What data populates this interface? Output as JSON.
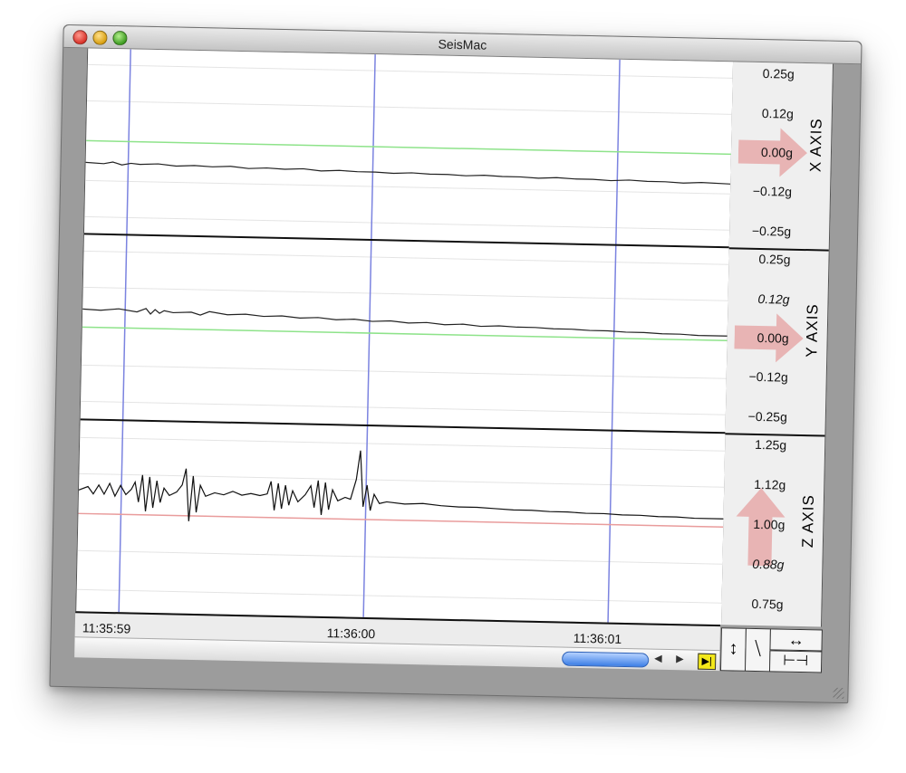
{
  "window": {
    "title": "SeisMac"
  },
  "icons": {
    "close": "close-button-icon",
    "minimize": "minimize-button-icon",
    "zoom": "zoom-button-icon",
    "vertical_zoom": "double-arrow-vertical-icon",
    "vertical_compress": "compress-vertical-icon",
    "horizontal_zoom": "double-arrow-horizontal-icon",
    "horizontal_compress": "compress-horizontal-icon",
    "scroll_left": "arrow-left-icon",
    "scroll_right": "arrow-right-icon",
    "jump_to_end": "jump-to-end-icon"
  },
  "colors": {
    "gridline_blue": "#7b83e0",
    "x_baseline": "#8ee38a",
    "y_baseline": "#8ee38a",
    "z_baseline": "#e99c9c",
    "axis_arrow": "#e8b4b4"
  },
  "panels": [
    {
      "axis_label": "X AXIS",
      "ticks": [
        "0.25g",
        "0.12g",
        "0.00g",
        "−0.12g",
        "−0.25g"
      ]
    },
    {
      "axis_label": "Y AXIS",
      "ticks": [
        "0.25g",
        "0.12g",
        "0.00g",
        "−0.12g",
        "−0.25g"
      ]
    },
    {
      "axis_label": "Z AXIS",
      "ticks": [
        "1.25g",
        "1.12g",
        "1.00g",
        "0.88g",
        "0.75g"
      ]
    }
  ],
  "time_axis": {
    "labels": [
      "11:35:59",
      "11:36:00",
      "11:36:01"
    ]
  }
}
